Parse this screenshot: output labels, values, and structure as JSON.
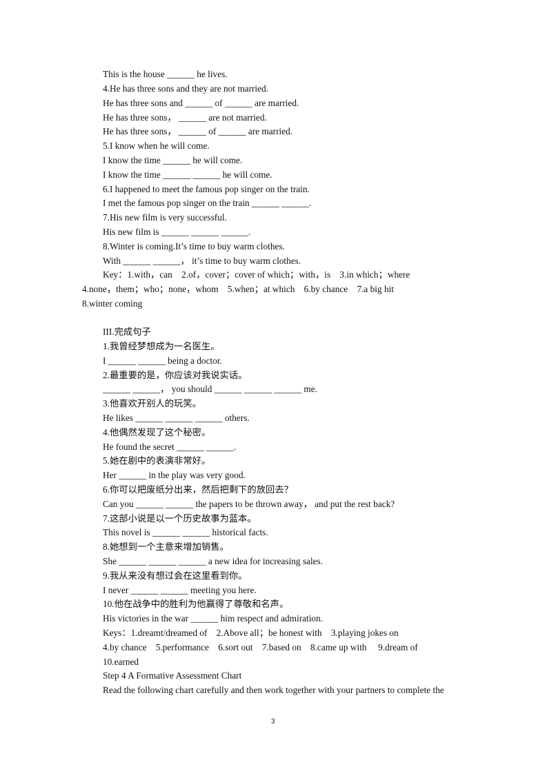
{
  "section2_lines": [
    "This is the house ______ he lives.",
    "4.He has three sons and they are not married.",
    "He has three sons and ______ of ______ are married.",
    "He has three sons， ______ are not married.",
    "He has three sons， ______ of ______ are married.",
    "5.I know when he will come.",
    "I know the time ______ he will come.",
    "I know the time ______ ______ he will come.",
    "6.I happened to meet the famous pop singer on the train.",
    "I met the famous pop singer on the train ______ ______.",
    "7.His new film is very successful.",
    "His new film is ______ ______ ______.",
    "8.Winter is coming.It’s time to buy warm clothes.",
    "With ______ ______， it’s time to buy warm clothes."
  ],
  "section2_key": {
    "line1": "Key：1.with，can    2.of，cover；cover of which；with，is    3.in which；where",
    "line2": "4.none，them；who；none，whom    5.when；at which    6.by chance    7.a big hit",
    "line3": "8.winter coming"
  },
  "section3": {
    "heading": "III.完成句子",
    "lines": [
      "1.我曾经梦想成为一名医生。",
      "I ______ ______ being a doctor.",
      "2.最重要的是，你应该对我说实话。",
      "______ ______， you should ______ ______ ______ me.",
      "3.他喜欢开别人的玩笑。",
      "He likes ______ ______ ______ others.",
      "4.他偶然发现了这个秘密。",
      "He found the secret ______ ______.",
      "5.她在剧中的表演非常好。",
      "Her ______ in the play was very good.",
      "6.你可以把废纸分出来，然后把剩下的放回去？",
      "Can you ______ ______ the papers to be thrown away， and put the rest back?",
      "7.这部小说是以一个历史故事为蓝本。",
      "This novel is ______ ______ historical facts.",
      "8.她想到一个主意来增加销售。",
      "She ______ ______ ______ a new idea for increasing sales.",
      "9.我从来没有想过会在这里看到你。",
      "I never ______ ______ meeting you here.",
      "10.他在战争中的胜利为他赢得了尊敬和名声。",
      "His victories in the war ______ him respect and admiration.",
      "Keys：1.dreamt/dreamed of    2.Above all；be honest with    3.playing jokes on",
      "4.by chance    5.performance    6.sort out    7.based on    8.came up with     9.dream of",
      "10.earned",
      "Step 4 A Formative Assessment Chart",
      "Read the following chart carefully and then work together with your partners to complete the"
    ]
  },
  "page_number": "3"
}
